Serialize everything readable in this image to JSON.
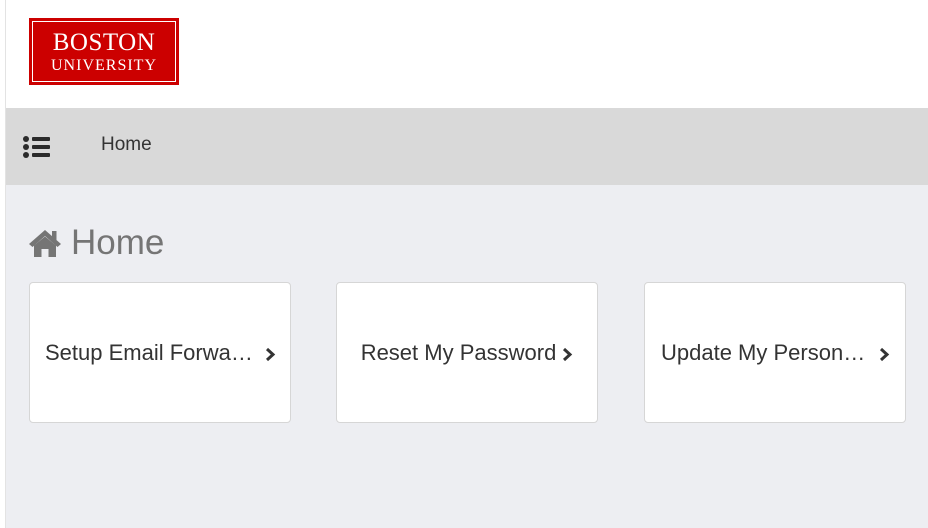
{
  "header": {
    "logo_line1": "BOSTON",
    "logo_line2": "UNIVERSITY"
  },
  "navbar": {
    "menu_icon": "list-icon",
    "home_link": "Home"
  },
  "main": {
    "title_icon": "home-icon",
    "title": "Home",
    "cards": [
      {
        "label": "Setup Email Forwarding",
        "icon": "chevron-right-icon"
      },
      {
        "label": "Reset My Password",
        "icon": "chevron-right-icon"
      },
      {
        "label": "Update My Personal Information",
        "icon": "chevron-right-icon"
      }
    ]
  },
  "colors": {
    "brand_red": "#cc0000",
    "navbar_bg": "#d9d9d9",
    "main_bg": "#edeef2",
    "title_gray": "#757575"
  }
}
